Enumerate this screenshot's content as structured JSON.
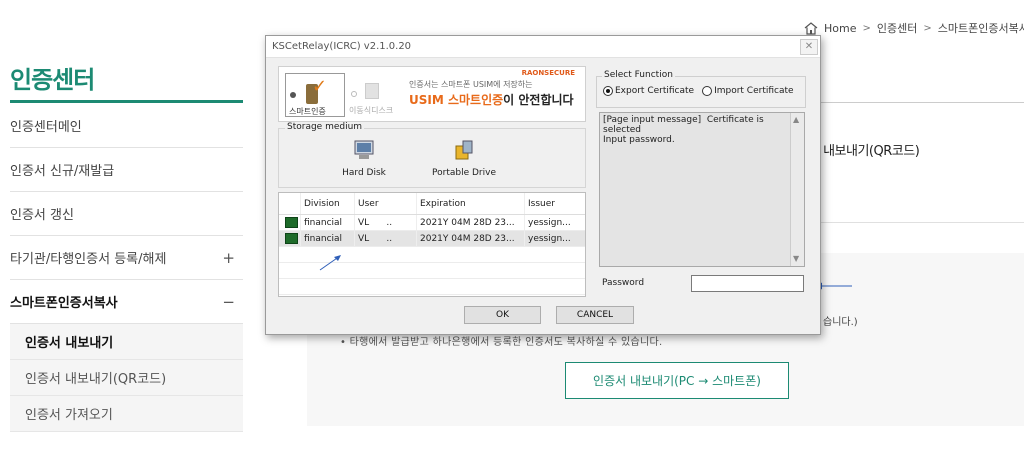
{
  "breadcrumb": {
    "home": "Home",
    "sep": ">",
    "level1": "인증센터",
    "level2": "스마트폰인증서복사"
  },
  "sidebar": {
    "title": "인증센터",
    "items": [
      {
        "label": "인증센터메인",
        "sign": ""
      },
      {
        "label": "인증서 신규/재발급",
        "sign": ""
      },
      {
        "label": "인증서 갱신",
        "sign": ""
      },
      {
        "label": "타기관/타행인증서 등록/해제",
        "sign": "+"
      },
      {
        "label": "스마트폰인증서복사",
        "sign": "−"
      }
    ],
    "subitems": [
      {
        "label": "인증서 내보내기"
      },
      {
        "label": "인증서 내보내기(QR코드)"
      },
      {
        "label": "인증서 가져오기"
      }
    ]
  },
  "main": {
    "heading": "서 내보내기(QR코드)",
    "text1": "습니다.)",
    "text2": "• 타행에서 발급받고 하나은행에서 등록한 인증서도 복사하실 수 있습니다.",
    "export_button": "인증서 내보내기(PC → 스마트폰)"
  },
  "dialog": {
    "title": "KSCetRelay(ICRC) v2.1.0.20",
    "close": "✕",
    "banner": {
      "opt1": "스마트인증",
      "opt2": "이동식디스크",
      "brand": "RAONSECURE",
      "line1": "인증서는 스마트폰 USIM에 저장하는",
      "line2_hl": "USIM 스마트인증",
      "line2_rest": "이 안전합니다"
    },
    "storage": {
      "legend": "Storage medium",
      "hard_disk": "Hard Disk",
      "portable_drive": "Portable Drive"
    },
    "table": {
      "headers": [
        "Division",
        "User",
        "Expiration",
        "Issuer"
      ],
      "rows": [
        {
          "division": "financial",
          "user": "VL",
          "dots": "..",
          "expiration": "2021Y 04M 28D 23...",
          "issuer": "yessign..."
        },
        {
          "division": "financial",
          "user": "VL",
          "dots": "..",
          "expiration": "2021Y 04M 28D 23...",
          "issuer": "yessign..."
        }
      ]
    },
    "select_function": {
      "legend": "Select Function",
      "export": "Export Certificate",
      "import": "Import Certificate"
    },
    "message": "[Page input message]  Certificate is selected\nInput password.",
    "password_label": "Password",
    "password_value": "",
    "ok": "OK",
    "cancel": "CANCEL"
  },
  "colors": {
    "brand_green": "#1c8a73",
    "accent_orange": "#e86a1a",
    "annotation_blue": "#2f5fb8"
  }
}
